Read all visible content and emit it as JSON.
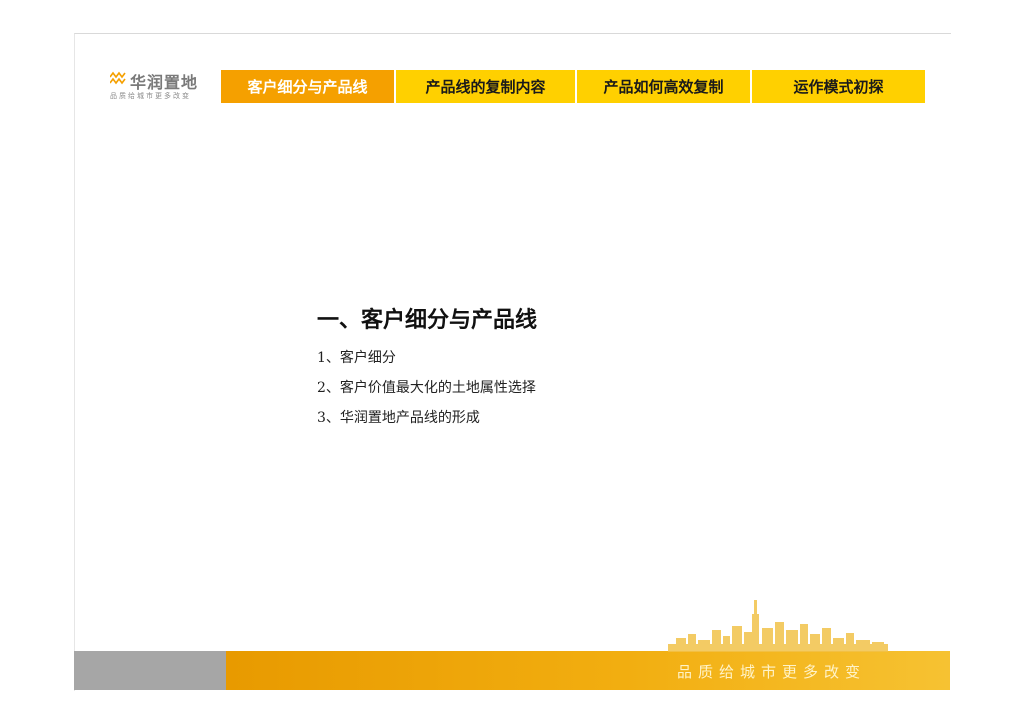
{
  "logo": {
    "name": "华润置地",
    "slogan": "品质给城市更多改变"
  },
  "nav": {
    "tabs": [
      {
        "label": "客户细分与产品线",
        "active": true
      },
      {
        "label": "产品线的复制内容",
        "active": false
      },
      {
        "label": "产品如何高效复制",
        "active": false
      },
      {
        "label": "运作模式初探",
        "active": false
      }
    ]
  },
  "main": {
    "heading": "一、客户细分与产品线",
    "items": [
      "1、客户细分",
      "2、客户价值最大化的土地属性选择",
      "3、华润置地产品线的形成"
    ]
  },
  "footer": {
    "slogan": "品质给城市更多改变"
  },
  "colors": {
    "tab": "#ffd000",
    "tab_active": "#f5a000",
    "footer_gold": "#f2ae10",
    "footer_gray": "#a6a6a6"
  }
}
